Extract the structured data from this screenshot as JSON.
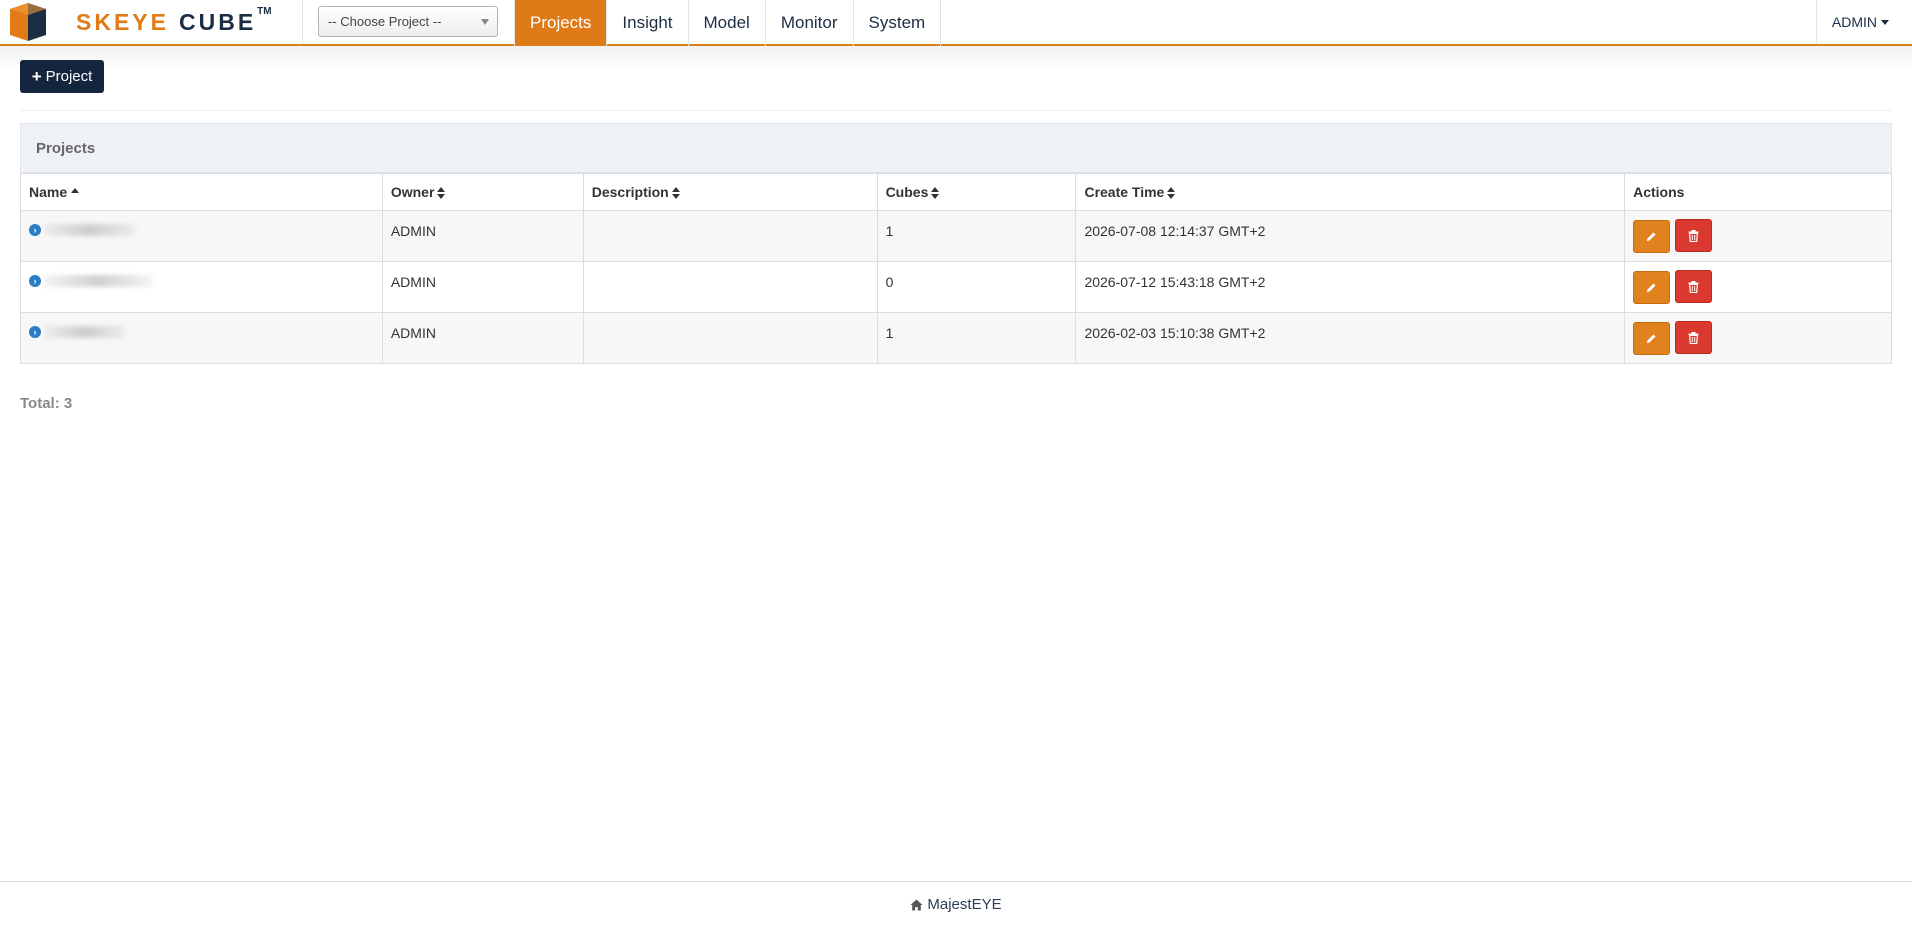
{
  "brand": {
    "word1": "SKEYE",
    "word2": "CUBE",
    "trademark": "TM"
  },
  "project_select": {
    "placeholder": "-- Choose Project --"
  },
  "nav": {
    "tabs": [
      {
        "label": "Projects",
        "active": true
      },
      {
        "label": "Insight",
        "active": false
      },
      {
        "label": "Model",
        "active": false
      },
      {
        "label": "Monitor",
        "active": false
      },
      {
        "label": "System",
        "active": false
      }
    ],
    "user_menu": "ADMIN"
  },
  "toolbar": {
    "add_project_label": "Project"
  },
  "panel": {
    "title": "Projects"
  },
  "table": {
    "columns": [
      "Name",
      "Owner",
      "Description",
      "Cubes",
      "Create Time",
      "Actions"
    ],
    "rows": [
      {
        "name": "",
        "owner": "ADMIN",
        "description": "",
        "cubes": "1",
        "create_time": "2026-07-08 12:14:37 GMT+2"
      },
      {
        "name": "",
        "owner": "ADMIN",
        "description": "",
        "cubes": "0",
        "create_time": "2026-07-12 15:43:18 GMT+2"
      },
      {
        "name": "",
        "owner": "ADMIN",
        "description": "",
        "cubes": "1",
        "create_time": "2026-02-03 15:10:38 GMT+2"
      }
    ]
  },
  "total_text": "Total: 3",
  "footer": {
    "label": "MajestEYE"
  },
  "colors": {
    "accent": "#df7b17",
    "navy": "#13263d",
    "danger": "#d9392f",
    "link": "#2a7cc4"
  },
  "icons": {
    "plus": "plus-icon",
    "expand": "chevron-circle-right-icon",
    "edit": "pencil-icon",
    "delete": "trash-icon",
    "home": "home-icon"
  }
}
